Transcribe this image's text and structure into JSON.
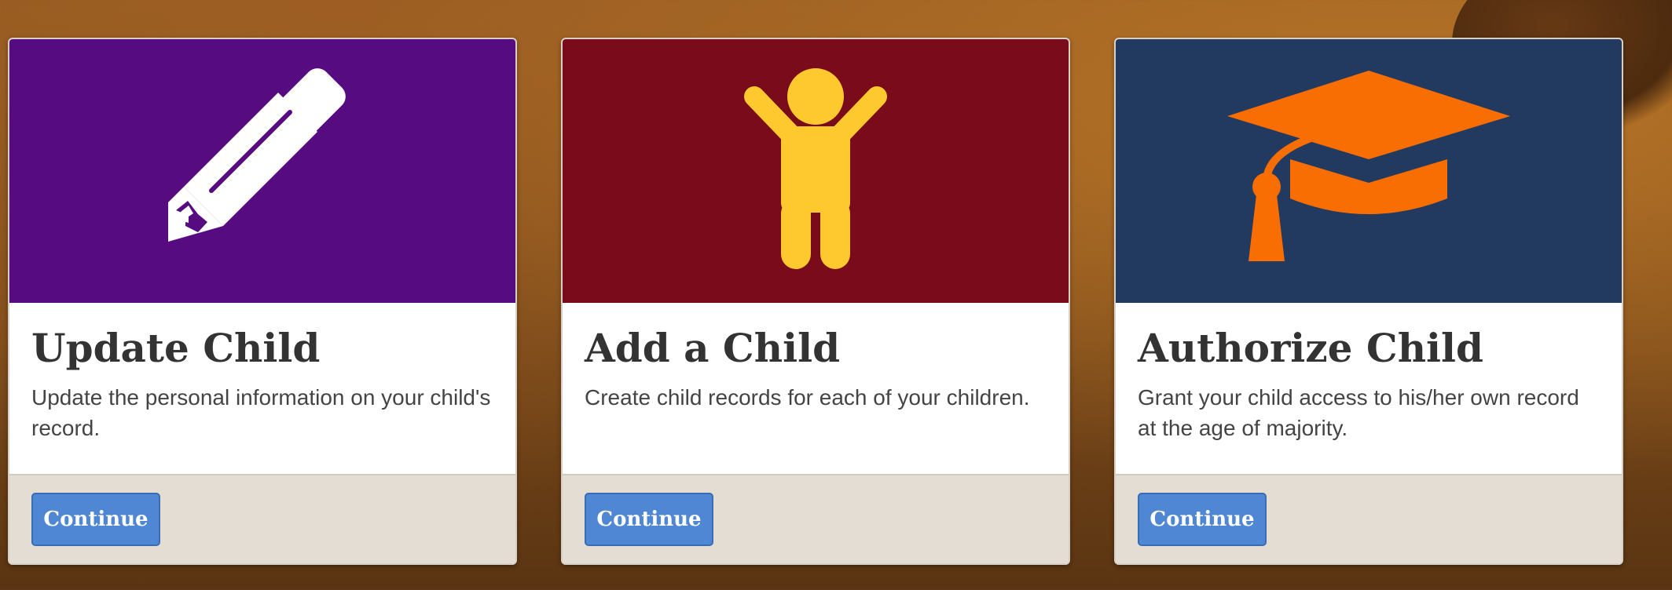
{
  "colors": {
    "update_hero": "#560c80",
    "add_hero": "#7a0b1a",
    "authorize_hero": "#223a60",
    "pencil": "#ffffff",
    "child_figure": "#fdc92f",
    "grad_cap": "#f96e02",
    "button": "#4f87d4"
  },
  "cards": [
    {
      "icon": "pencil-icon",
      "title": "Update Child",
      "description": "Update the personal information on your child's record.",
      "button_label": "Continue"
    },
    {
      "icon": "child-figure-icon",
      "title": "Add a Child",
      "description": "Create child records for each of your children.",
      "button_label": "Continue"
    },
    {
      "icon": "graduation-cap-icon",
      "title": "Authorize Child",
      "description": "Grant your child access to his/her own record at the age of majority.",
      "button_label": "Continue"
    }
  ]
}
